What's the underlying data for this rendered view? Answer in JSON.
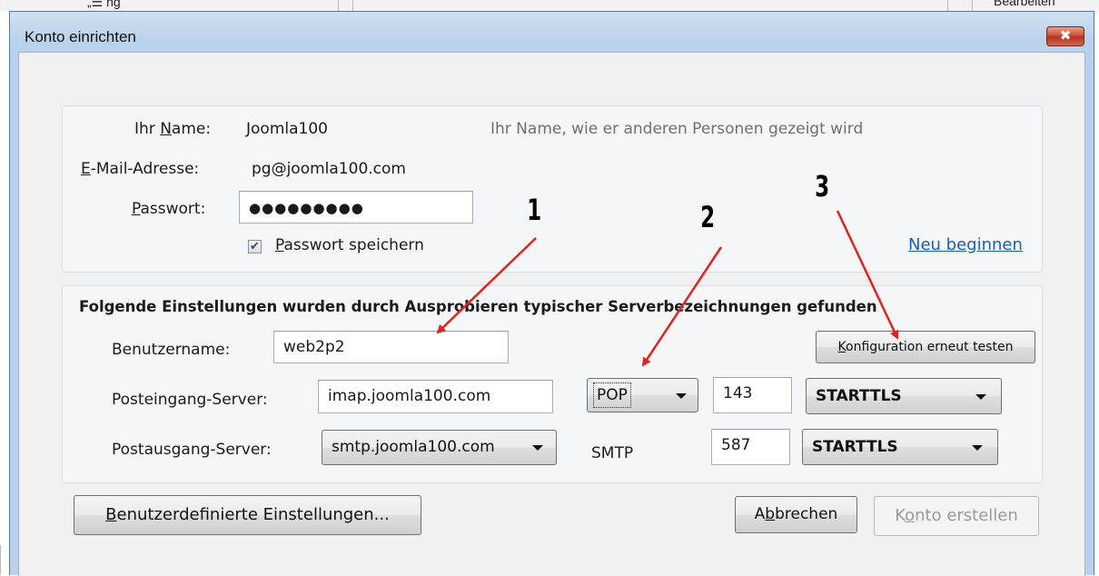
{
  "background": {
    "top_text": "„☰ ng",
    "top_right_text": "Bearbeiten"
  },
  "window": {
    "title": "Konto einrichten",
    "close_glyph": "✖"
  },
  "account": {
    "name_label_pre": "Ihr ",
    "name_label_access": "N",
    "name_label_post": "ame:",
    "name_value": "Joomla100",
    "name_hint": "Ihr Name, wie er anderen Personen gezeigt wird",
    "email_label_access": "E",
    "email_label_post": "-Mail-Adresse:",
    "email_value": "pg@joomla100.com",
    "password_label_access": "P",
    "password_label_post": "asswort:",
    "password_value": "●●●●●●●●●",
    "save_password_access": "P",
    "save_password_post": "asswort speichern",
    "save_password_checked": true,
    "restart_link": "Neu beginnen"
  },
  "settings": {
    "heading": "Folgende Einstellungen wurden durch Ausprobieren typischer Serverbezeichnungen gefunden",
    "username_label": "Benutzername:",
    "username_value": "web2p2",
    "retest_access": "K",
    "retest_post": "onfiguration erneut testen",
    "incoming_label": "Posteingang-Server:",
    "incoming_host": "imap.joomla100.com",
    "incoming_protocol": "POP",
    "incoming_port": "143",
    "incoming_security": "STARTTLS",
    "outgoing_label": "Postausgang-Server:",
    "outgoing_host": "smtp.joomla100.com",
    "outgoing_protocol": "SMTP",
    "outgoing_port": "587",
    "outgoing_security": "STARTTLS"
  },
  "footer": {
    "advanced_access": "B",
    "advanced_post": "enutzerdefinierte Einstellungen...",
    "cancel_pre": "A",
    "cancel_access": "b",
    "cancel_post": "brechen",
    "create_pre": "K",
    "create_access": "o",
    "create_post": "nto erstellen"
  },
  "annotations": {
    "num1": "1",
    "num2": "2",
    "num3": "3",
    "arrow_color": "#e0231e"
  }
}
